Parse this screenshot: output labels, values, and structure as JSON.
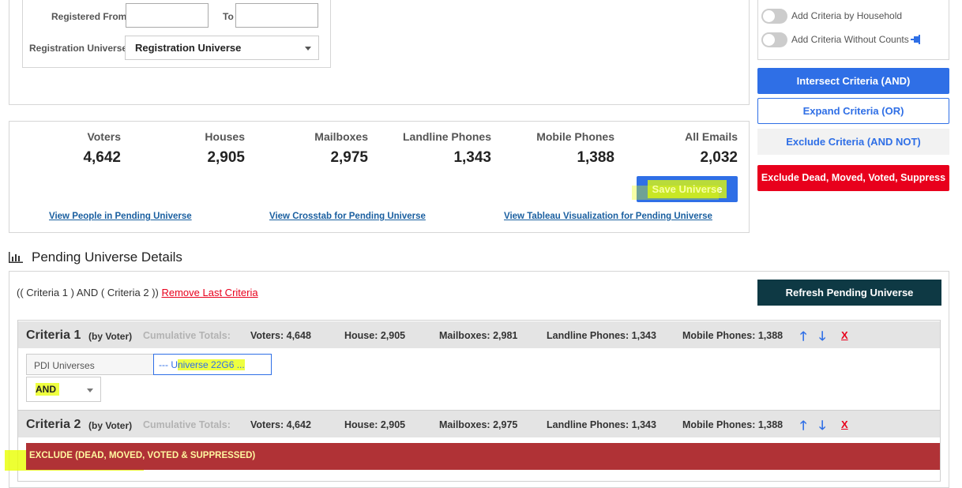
{
  "form": {
    "registered_from_label": "Registered From",
    "to_label": "To",
    "registered_from_value": "",
    "to_value": "",
    "universe_label": "Registration Universe",
    "universe_value": "Registration Universe"
  },
  "options": {
    "household_label": "Add Criteria by Household",
    "household_on": false,
    "without_counts_label": "Add Criteria Without Counts",
    "without_counts_on": false,
    "pin_icon": "pin-icon"
  },
  "actions": {
    "intersect": "Intersect Criteria (AND)",
    "expand": "Expand Criteria (OR)",
    "exclude": "Exclude Criteria (AND NOT)",
    "exclude_dead": "Exclude Dead, Moved, Voted, Suppress"
  },
  "stats": [
    {
      "label": "Voters",
      "value": "4,642"
    },
    {
      "label": "Houses",
      "value": "2,905"
    },
    {
      "label": "Mailboxes",
      "value": "2,975"
    },
    {
      "label": "Landline Phones",
      "value": "1,343"
    },
    {
      "label": "Mobile Phones",
      "value": "1,388"
    },
    {
      "label": "All Emails",
      "value": "2,032"
    }
  ],
  "save_universe": "Save Universe",
  "links": {
    "people": "View People in Pending Universe",
    "crosstab": "View Crosstab for Pending Universe",
    "tableau": "View Tableau Visualization for Pending Universe"
  },
  "pending": {
    "title": "Pending Universe Details",
    "expression": "(( Criteria 1 ) AND ( Criteria 2 ))",
    "remove_last": "Remove Last Criteria",
    "refresh": "Refresh Pending Universe"
  },
  "criteria": [
    {
      "title": "Criteria 1",
      "by": "(by Voter)",
      "cumulative": "Cumulative Totals:",
      "voters": "Voters: 4,648",
      "house": "House: 2,905",
      "mailboxes": "Mailboxes: 2,981",
      "landline": "Landline Phones: 1,343",
      "mobile": "Mobile Phones: 1,388",
      "up": "🡑",
      "down": "🡓",
      "remove": "X",
      "source": "PDI Universes",
      "universe_prefix": "--- U",
      "universe_rest": "niverse 22G6 ...",
      "operator": "AND"
    },
    {
      "title": "Criteria 2",
      "by": "(by Voter)",
      "cumulative": "Cumulative Totals:",
      "voters": "Voters: 4,642",
      "house": "House: 2,905",
      "mailboxes": "Mailboxes: 2,975",
      "landline": "Landline Phones: 1,343",
      "mobile": "Mobile Phones: 1,388",
      "up": "🡑",
      "down": "🡓",
      "remove": "X",
      "exclude_label": "EXCLUDE (DEAD, MOVED, VOTED & SUPPRESSED)"
    }
  ],
  "colors": {
    "primary": "#2f6fe6",
    "danger": "#e8001c",
    "dark": "#0e3944",
    "exclude_bar": "#b03236",
    "highlight": "#e8ff00"
  }
}
